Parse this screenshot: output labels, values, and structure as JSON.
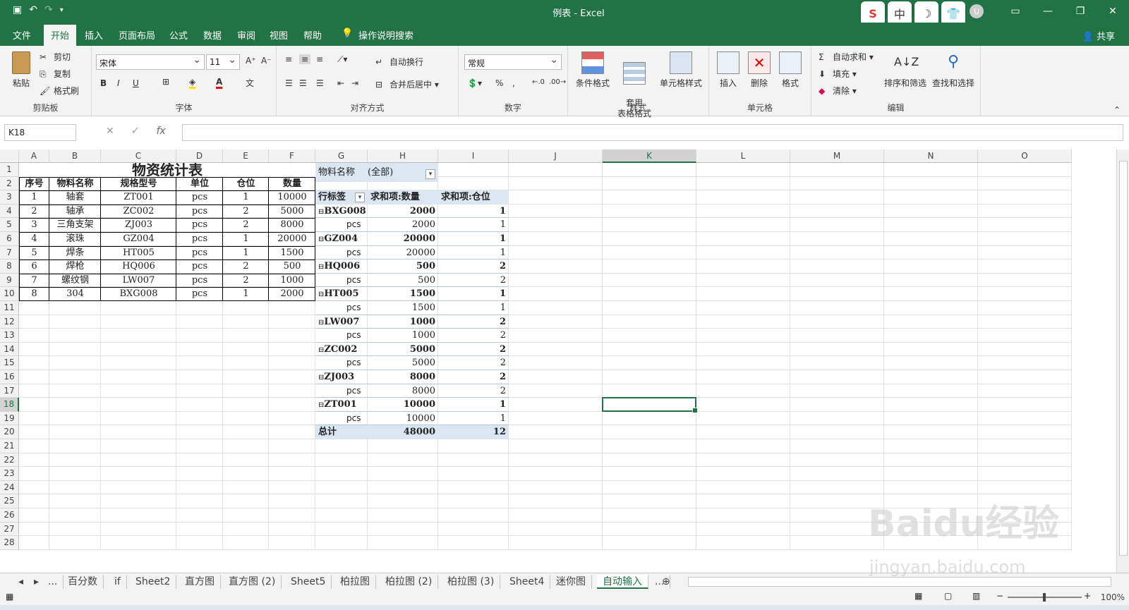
{
  "window": {
    "title": "例表 - Excel",
    "share": "共享",
    "ime": [
      "S",
      "中",
      "☽",
      "👕"
    ],
    "avatar": "U"
  },
  "tabs": [
    "文件",
    "开始",
    "插入",
    "页面布局",
    "公式",
    "数据",
    "审阅",
    "视图",
    "帮助",
    "操作说明搜索"
  ],
  "active_tab": "开始",
  "ribbon": {
    "clipboard": {
      "paste": "粘贴",
      "cut": "剪切",
      "copy": "复制",
      "format_painter": "格式刷",
      "label": "剪贴板"
    },
    "font": {
      "name": "宋体",
      "size": "11",
      "grow": "A^",
      "shrink": "A",
      "bold": "B",
      "italic": "I",
      "underline": "U",
      "label": "字体"
    },
    "alignment": {
      "wrap": "自动换行",
      "merge": "合并后居中",
      "label": "对齐方式"
    },
    "number": {
      "format": "常规",
      "percent": "%",
      "comma": ",",
      "label": "数字"
    },
    "styles": {
      "conditional": "条件格式",
      "table": "套用\n表格格式",
      "cell_styles": "单元格样式",
      "label": "样式"
    },
    "cells": {
      "insert": "插入",
      "delete": "删除",
      "format": "格式",
      "label": "单元格"
    },
    "editing": {
      "autosum": "自动求和",
      "fill": "填充",
      "clear": "清除",
      "sort": "排序和筛选",
      "find": "查找和选择",
      "label": "编辑"
    }
  },
  "formula_bar": {
    "name_box": "K18",
    "fx": "fx",
    "value": ""
  },
  "columns": [
    "A",
    "B",
    "C",
    "D",
    "E",
    "F",
    "G",
    "H",
    "I",
    "J",
    "K",
    "L",
    "M",
    "N",
    "O"
  ],
  "selected_column": "K",
  "rows": [
    "1",
    "2",
    "3",
    "4",
    "5",
    "6",
    "7",
    "8",
    "9",
    "10",
    "11",
    "12",
    "13",
    "14",
    "15",
    "16",
    "17",
    "18",
    "19",
    "20",
    "21",
    "22",
    "23",
    "24",
    "25",
    "26",
    "27",
    "28"
  ],
  "selected_row": "18",
  "table": {
    "title": "物资统计表",
    "headers": [
      "序号",
      "物料名称",
      "规格型号",
      "单位",
      "仓位",
      "数量"
    ],
    "rows": [
      [
        "1",
        "轴套",
        "ZT001",
        "pcs",
        "1",
        "10000"
      ],
      [
        "2",
        "轴承",
        "ZC002",
        "pcs",
        "2",
        "5000"
      ],
      [
        "3",
        "三角支架",
        "ZJ003",
        "pcs",
        "2",
        "8000"
      ],
      [
        "4",
        "滚珠",
        "GZ004",
        "pcs",
        "1",
        "20000"
      ],
      [
        "5",
        "焊条",
        "HT005",
        "pcs",
        "1",
        "1500"
      ],
      [
        "6",
        "焊枪",
        "HQ006",
        "pcs",
        "2",
        "500"
      ],
      [
        "7",
        "螺纹钢",
        "LW007",
        "pcs",
        "2",
        "1000"
      ],
      [
        "8",
        "304",
        "BXG008",
        "pcs",
        "1",
        "2000"
      ]
    ]
  },
  "pivot": {
    "filter_label": "物料名称",
    "filter_value": "(全部)",
    "headers": [
      "行标签",
      "求和项:数量",
      "求和项:仓位"
    ],
    "groups": [
      {
        "key": "BXG008",
        "qty": "2000",
        "pos": "1",
        "sub": "pcs",
        "sub_qty": "2000",
        "sub_pos": "1"
      },
      {
        "key": "GZ004",
        "qty": "20000",
        "pos": "1",
        "sub": "pcs",
        "sub_qty": "20000",
        "sub_pos": "1"
      },
      {
        "key": "HQ006",
        "qty": "500",
        "pos": "2",
        "sub": "pcs",
        "sub_qty": "500",
        "sub_pos": "2"
      },
      {
        "key": "HT005",
        "qty": "1500",
        "pos": "1",
        "sub": "pcs",
        "sub_qty": "1500",
        "sub_pos": "1"
      },
      {
        "key": "LW007",
        "qty": "1000",
        "pos": "2",
        "sub": "pcs",
        "sub_qty": "1000",
        "sub_pos": "2"
      },
      {
        "key": "ZC002",
        "qty": "5000",
        "pos": "2",
        "sub": "pcs",
        "sub_qty": "5000",
        "sub_pos": "2"
      },
      {
        "key": "ZJ003",
        "qty": "8000",
        "pos": "2",
        "sub": "pcs",
        "sub_qty": "8000",
        "sub_pos": "2"
      },
      {
        "key": "ZT001",
        "qty": "10000",
        "pos": "1",
        "sub": "pcs",
        "sub_qty": "10000",
        "sub_pos": "1"
      }
    ],
    "total_label": "总计",
    "total_qty": "48000",
    "total_pos": "12"
  },
  "sheet_tabs": [
    "...",
    "百分数",
    "if",
    "Sheet2",
    "直方图",
    "直方图 (2)",
    "Sheet5",
    "柏拉图",
    "柏拉图 (2)",
    "柏拉图 (3)",
    "Sheet4",
    "迷你图",
    "自动输入",
    "..."
  ],
  "active_sheet": "自动输入",
  "status": {
    "zoom": "100%"
  },
  "watermark": {
    "main": "Baidu经验",
    "sub": "jingyan.baidu.com"
  },
  "colors": {
    "accent": "#217346",
    "pivot_header": "#dce6f1"
  }
}
